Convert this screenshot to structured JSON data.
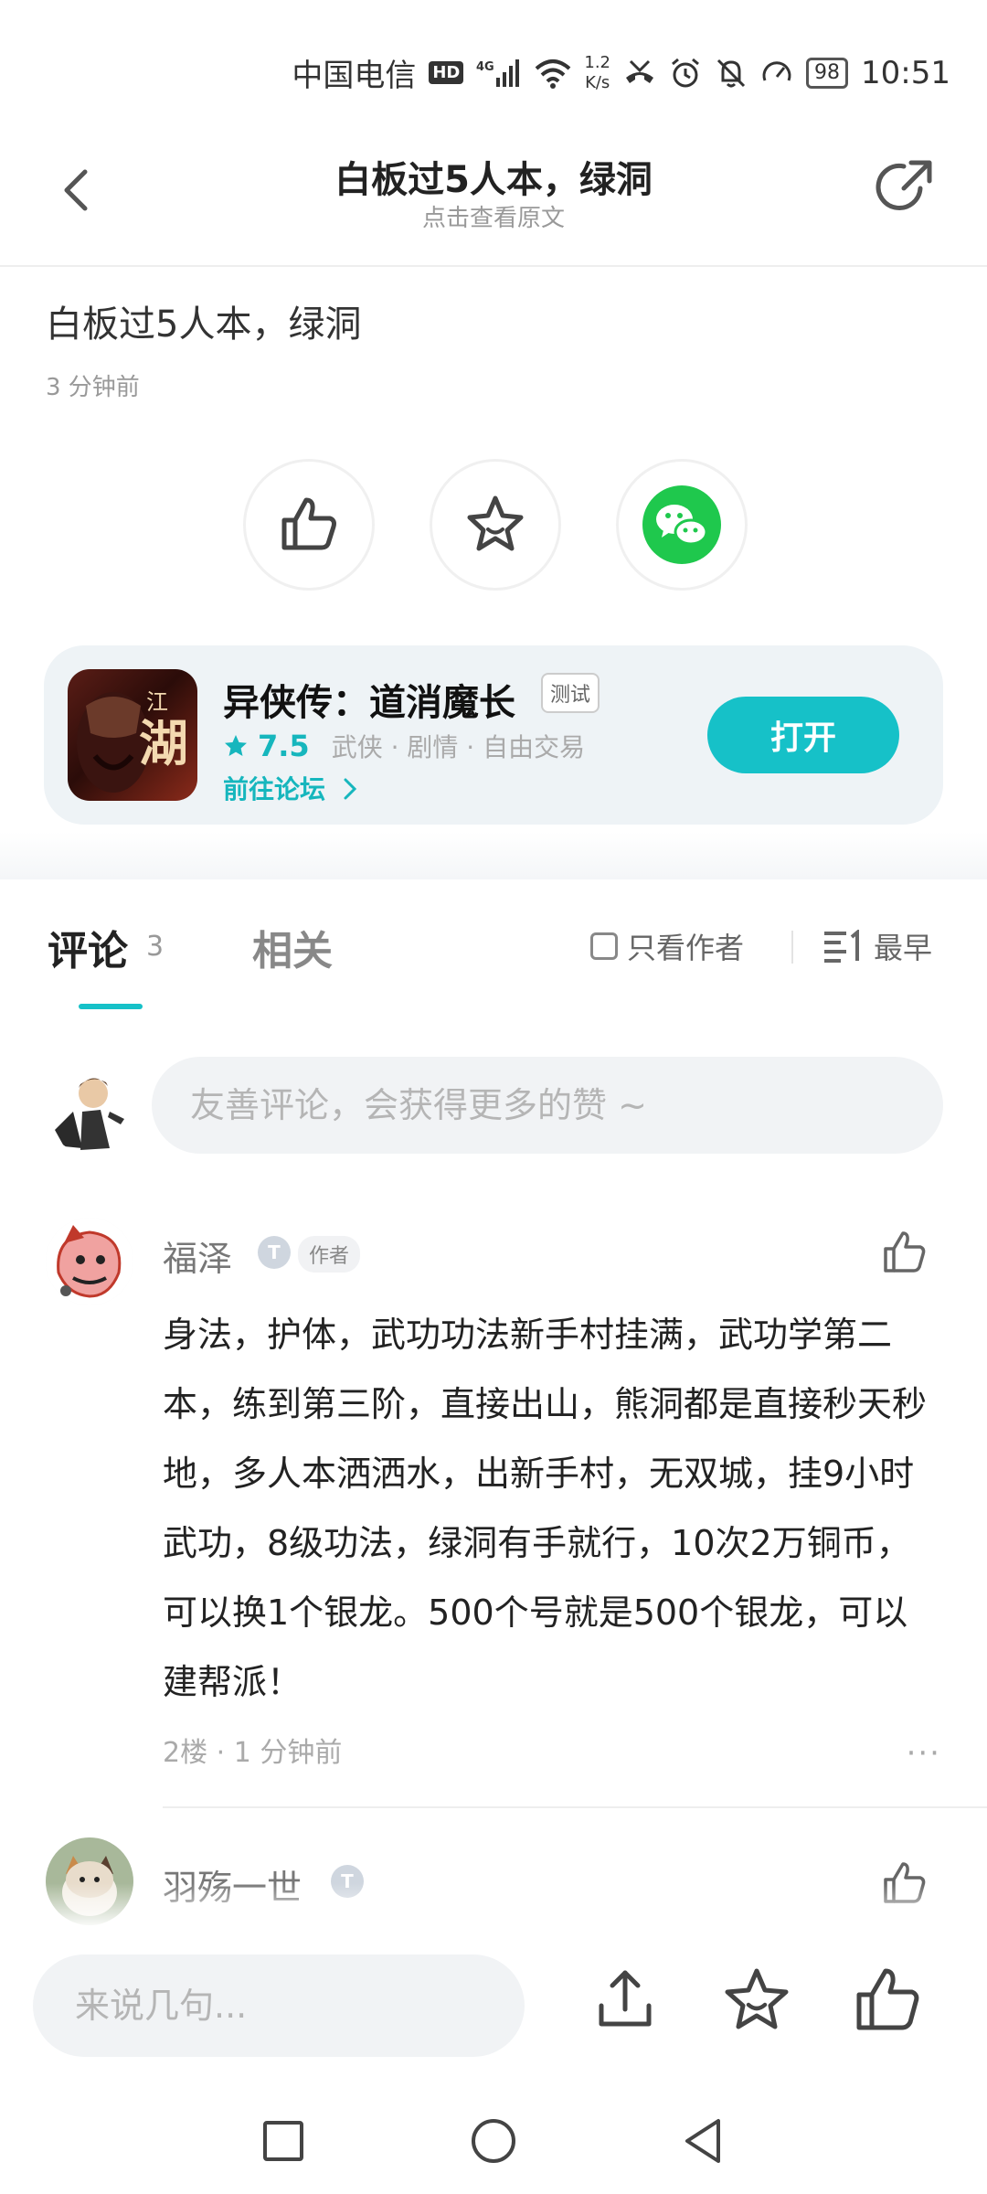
{
  "status_bar": {
    "carrier": "中国电信",
    "hd": "HD",
    "net_speed_value": "1.2",
    "net_speed_unit": "K/s",
    "battery": "98",
    "time": "10:51"
  },
  "header": {
    "title": "白板过5人本，绿洞",
    "subtitle": "点击查看原文"
  },
  "post": {
    "title": "白板过5人本，绿洞",
    "time": "3 分钟前"
  },
  "game_card": {
    "name": "异侠传：道消魔长",
    "tag": "测试",
    "rating": "7.5",
    "genres": "武侠 · 剧情 · 自由交易",
    "forum_link": "前往论坛",
    "open_button": "打开",
    "icon_text_top": "江",
    "icon_text_main": "湖"
  },
  "tabs": {
    "comments": "评论",
    "comments_count": "3",
    "related": "相关",
    "only_author": "只看作者",
    "sort": "最早"
  },
  "comment_input": {
    "placeholder": "友善评论，会获得更多的赞 ~"
  },
  "comments": [
    {
      "name": "福泽",
      "badge": "T",
      "author_tag": "作者",
      "body": "身法，护体，武功功法新手村挂满，武功学第二本，练到第三阶，直接出山，熊洞都是直接秒天秒地，多人本洒洒水，出新手村，无双城，挂9小时武功，8级功法，绿洞有手就行，10次2万铜币，可以换1个银龙。500个号就是500个银龙，可以建帮派！",
      "meta": "2楼 · 1 分钟前",
      "more": "···"
    },
    {
      "name": "羽殇一世",
      "badge": "T"
    }
  ],
  "bottom_bar": {
    "placeholder": "来说几句..."
  },
  "colors": {
    "accent": "#16c1c8",
    "wechat": "#1fc84d"
  }
}
